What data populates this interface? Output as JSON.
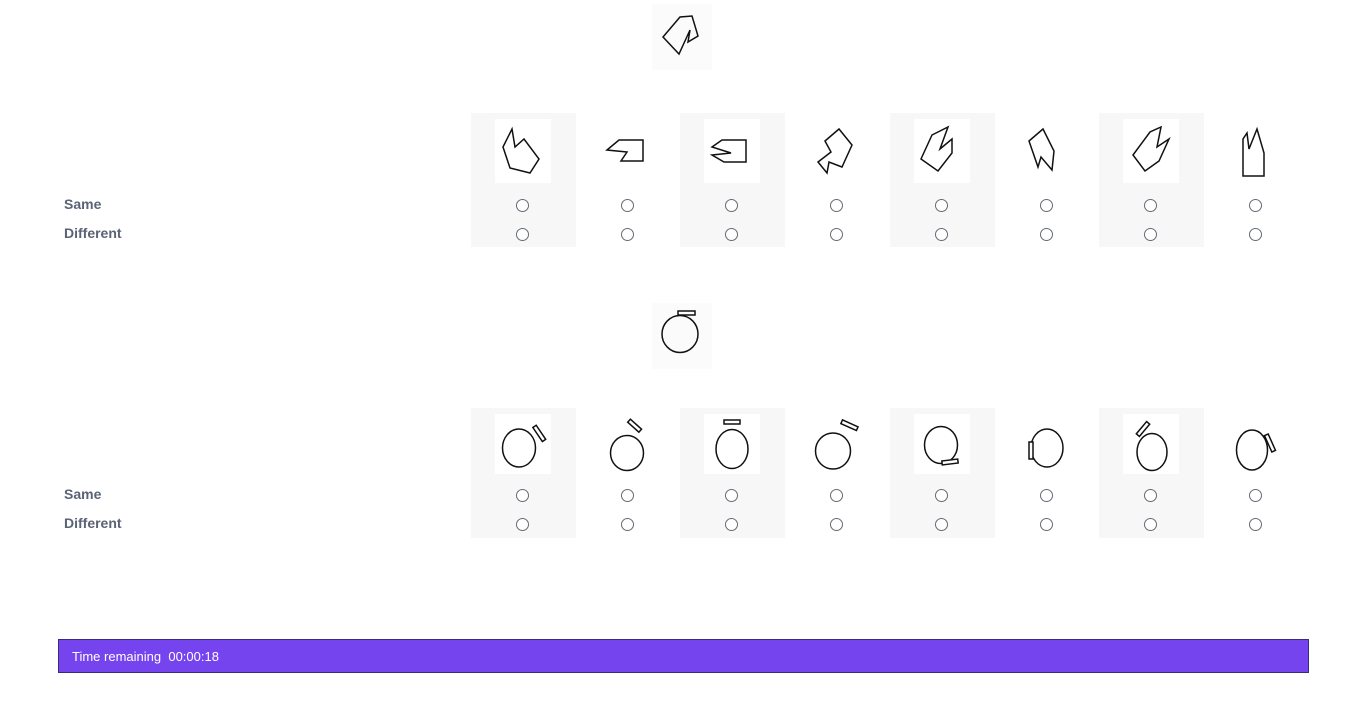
{
  "questions": [
    {
      "target_shape": "polygon-notched-shape",
      "row_labels": {
        "same": "Same",
        "different": "Different"
      },
      "options": [
        {
          "shape": "polygon-option-1"
        },
        {
          "shape": "polygon-option-2"
        },
        {
          "shape": "polygon-option-3"
        },
        {
          "shape": "polygon-option-4"
        },
        {
          "shape": "polygon-option-5"
        },
        {
          "shape": "polygon-option-6"
        },
        {
          "shape": "polygon-option-7"
        },
        {
          "shape": "polygon-option-8"
        }
      ]
    },
    {
      "target_shape": "circle-with-tab-shape",
      "row_labels": {
        "same": "Same",
        "different": "Different"
      },
      "options": [
        {
          "shape": "circle-option-1"
        },
        {
          "shape": "circle-option-2"
        },
        {
          "shape": "circle-option-3"
        },
        {
          "shape": "circle-option-4"
        },
        {
          "shape": "circle-option-5"
        },
        {
          "shape": "circle-option-6"
        },
        {
          "shape": "circle-option-7"
        },
        {
          "shape": "circle-option-8"
        }
      ]
    }
  ],
  "timer": {
    "label": "Time remaining",
    "value": "00:00:18"
  },
  "colors": {
    "timer_bg": "#7644ee",
    "label_text": "#5a6275",
    "column_shade": "#f7f7f8"
  }
}
